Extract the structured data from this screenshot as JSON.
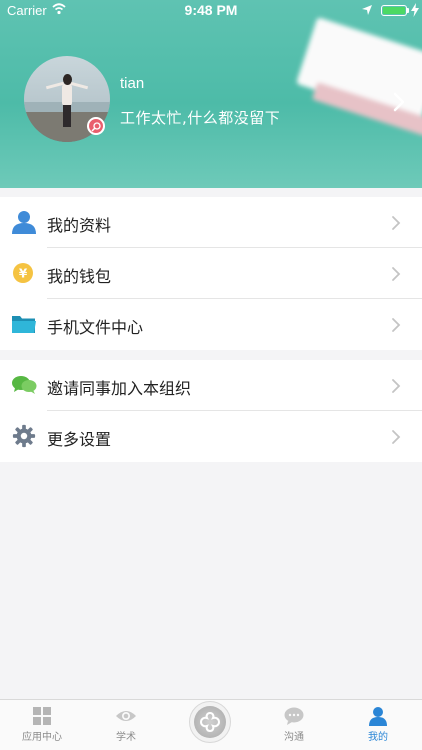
{
  "status_bar": {
    "carrier": "Carrier",
    "time": "9:48 PM"
  },
  "profile": {
    "name": "tian",
    "signature": "工作太忙,什么都没留下"
  },
  "menu_group_1": [
    {
      "label": "我的资料",
      "icon": "user-profile-icon"
    },
    {
      "label": "我的钱包",
      "icon": "yen-wallet-icon"
    },
    {
      "label": "手机文件中心",
      "icon": "folder-icon"
    }
  ],
  "menu_group_2": [
    {
      "label": "邀请同事加入本组织",
      "icon": "chat-bubbles-icon"
    },
    {
      "label": "更多设置",
      "icon": "gear-icon"
    }
  ],
  "tabbar": {
    "tabs": [
      {
        "label": "应用中心",
        "icon": "grid-apps-icon"
      },
      {
        "label": "学术",
        "icon": "eye-icon"
      },
      {
        "label": "",
        "icon": "center-action-icon"
      },
      {
        "label": "沟通",
        "icon": "chat-icon"
      },
      {
        "label": "我的",
        "icon": "person-icon"
      }
    ],
    "active_index": 4
  },
  "colors": {
    "header_bg": "#4dbba8",
    "accent_blue": "#2b86d6",
    "tab_inactive": "#8c8c8c",
    "battery": "#4cd964",
    "badge": "#e95f6d"
  }
}
